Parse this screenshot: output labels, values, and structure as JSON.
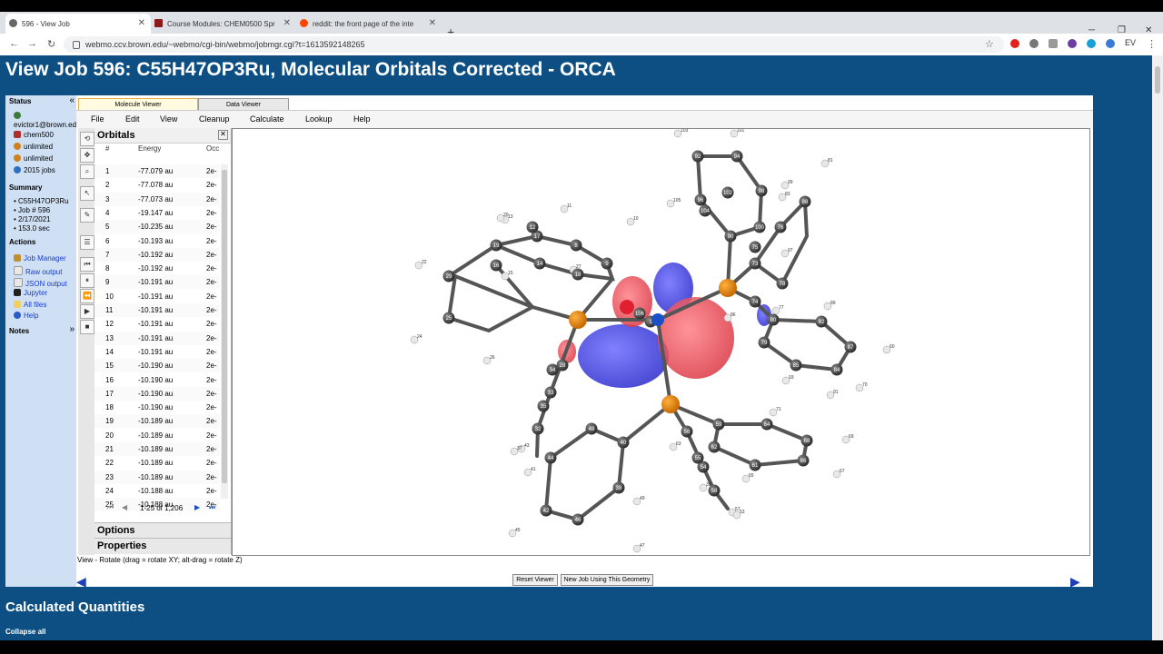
{
  "browser": {
    "tabs": [
      {
        "title": "596 - View Job",
        "color": "#555555"
      },
      {
        "title": "Course Modules: CHEM0500 Spr",
        "color": "#8b1a1a"
      },
      {
        "title": "reddit: the front page of the inte",
        "color": "#ff4500"
      }
    ],
    "url": "webmo.ccv.brown.edu/~webmo/cgi-bin/webmo/jobmgr.cgi?t=1613592148265",
    "profile": "EV"
  },
  "page": {
    "title": "View Job 596: C55H47OP3Ru, Molecular Orbitals Corrected - ORCA",
    "calc_title": "Calculated Quantities",
    "collapse_all": "Collapse all"
  },
  "left": {
    "status_label": "Status",
    "user": "evictor1@brown.ed",
    "group": "chem500",
    "quota1": "unlimited",
    "quota2": "unlimited",
    "jobs": "2015 jobs",
    "summary_label": "Summary",
    "summary": [
      "C55H47OP3Ru",
      "Job # 596",
      "2/17/2021",
      "153.0 sec"
    ],
    "actions_label": "Actions",
    "actions": [
      "Job Manager",
      "Raw output",
      "JSON output",
      "Jupyter",
      "All files",
      "Help"
    ],
    "notes_label": "Notes",
    "collapse_glyph": "«",
    "expand_glyph": "»"
  },
  "viewer": {
    "tabs": [
      "Molecule Viewer",
      "Data Viewer"
    ],
    "menu": [
      "File",
      "Edit",
      "View",
      "Cleanup",
      "Calculate",
      "Lookup",
      "Help"
    ],
    "status": "View - Rotate (drag = rotate XY; alt-drag = rotate Z)",
    "reset_button": "Reset Viewer",
    "newjob_button": "New Job Using This Geometry"
  },
  "orbitals": {
    "title": "Orbitals",
    "columns": [
      "#",
      "Energy",
      "Occ"
    ],
    "rows": [
      [
        "1",
        "-77.079 au",
        "2e-"
      ],
      [
        "2",
        "-77.078 au",
        "2e-"
      ],
      [
        "3",
        "-77.073 au",
        "2e-"
      ],
      [
        "4",
        "-19.147 au",
        "2e-"
      ],
      [
        "5",
        "-10.235 au",
        "2e-"
      ],
      [
        "6",
        "-10.193 au",
        "2e-"
      ],
      [
        "7",
        "-10.192 au",
        "2e-"
      ],
      [
        "8",
        "-10.192 au",
        "2e-"
      ],
      [
        "9",
        "-10.191 au",
        "2e-"
      ],
      [
        "10",
        "-10.191 au",
        "2e-"
      ],
      [
        "11",
        "-10.191 au",
        "2e-"
      ],
      [
        "12",
        "-10.191 au",
        "2e-"
      ],
      [
        "13",
        "-10.191 au",
        "2e-"
      ],
      [
        "14",
        "-10.191 au",
        "2e-"
      ],
      [
        "15",
        "-10.190 au",
        "2e-"
      ],
      [
        "16",
        "-10.190 au",
        "2e-"
      ],
      [
        "17",
        "-10.190 au",
        "2e-"
      ],
      [
        "18",
        "-10.190 au",
        "2e-"
      ],
      [
        "19",
        "-10.189 au",
        "2e-"
      ],
      [
        "20",
        "-10.189 au",
        "2e-"
      ],
      [
        "21",
        "-10.189 au",
        "2e-"
      ],
      [
        "22",
        "-10.189 au",
        "2e-"
      ],
      [
        "23",
        "-10.189 au",
        "2e-"
      ],
      [
        "24",
        "-10.188 au",
        "2e-"
      ],
      [
        "25",
        "-10.188 au",
        "2e-"
      ]
    ],
    "pager": "1-25 of 1,206",
    "options": "Options",
    "properties": "Properties"
  },
  "atom_labels": {
    "c": [
      "17",
      "12",
      "19",
      "8",
      "9",
      "18",
      "14",
      "16",
      "29",
      "25",
      "107",
      "106",
      "1",
      "33",
      "34",
      "28",
      "32",
      "35",
      "42",
      "44",
      "46",
      "48",
      "38",
      "40",
      "56",
      "54",
      "55",
      "58",
      "59",
      "61",
      "62",
      "64",
      "66",
      "68",
      "73",
      "74",
      "75",
      "76",
      "78",
      "79",
      "80",
      "82",
      "84",
      "85",
      "87",
      "88",
      "90",
      "92",
      "94",
      "96",
      "98",
      "100",
      "102",
      "104"
    ],
    "h": [
      "11",
      "13",
      "10",
      "20",
      "22",
      "24",
      "26",
      "15",
      "27",
      "103",
      "101",
      "105",
      "99",
      "83",
      "81",
      "71",
      "69",
      "67",
      "65",
      "63",
      "57",
      "53",
      "47",
      "49",
      "45",
      "43",
      "41",
      "89",
      "93",
      "97",
      "91",
      "86",
      "77",
      "70",
      "60",
      "39",
      "37"
    ]
  }
}
